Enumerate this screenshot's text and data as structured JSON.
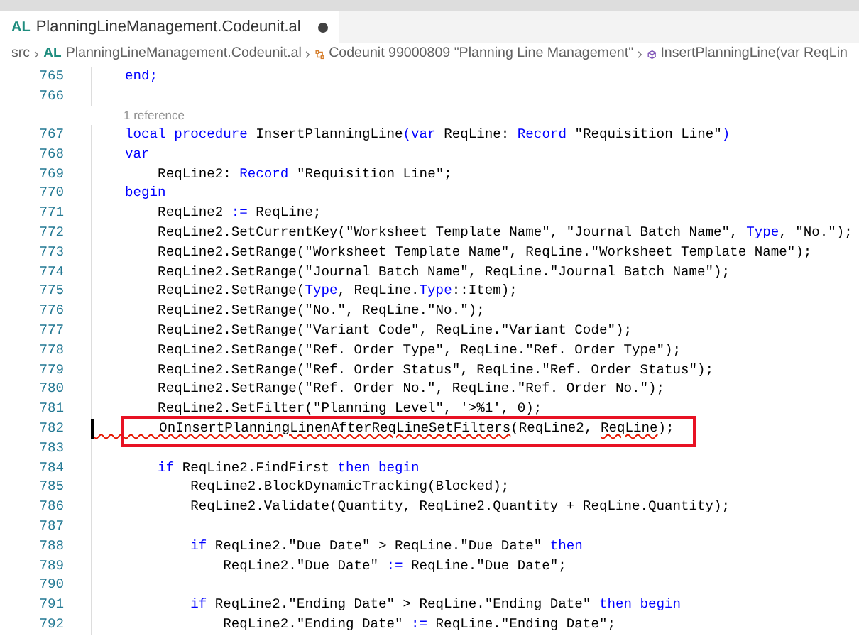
{
  "tab": {
    "lang": "AL",
    "title": "PlanningLineManagement.Codeunit.al",
    "modified": true
  },
  "breadcrumb": [
    {
      "kind": "folder",
      "text": "src"
    },
    {
      "kind": "file",
      "lang": "AL",
      "text": "PlanningLineManagement.Codeunit.al"
    },
    {
      "kind": "codeunit",
      "text": "Codeunit 99000809 \"Planning Line Management\""
    },
    {
      "kind": "method",
      "text": "InsertPlanningLine(var ReqLin"
    }
  ],
  "lines": [
    {
      "number": "765",
      "highlighted": false,
      "current": false,
      "segments": [
        {
          "kind": "keyword",
          "text": "    end;"
        }
      ]
    },
    {
      "number": "766",
      "highlighted": false,
      "current": false
    },
    {
      "kind": "codelens",
      "text": "1 reference"
    },
    {
      "number": "767",
      "highlighted": false,
      "current": false,
      "segments": [
        {
          "kind": "keyword",
          "text": "    local procedure "
        },
        {
          "kind": "plain",
          "text": "InsertPlanningLine"
        },
        {
          "kind": "keyword",
          "text": "(var "
        },
        {
          "kind": "plain",
          "text": "ReqLine: "
        },
        {
          "kind": "keyword",
          "text": "Record "
        },
        {
          "kind": "plain",
          "text": "\"Requisition Line\""
        },
        {
          "kind": "keyword",
          "text": ")"
        }
      ]
    },
    {
      "number": "768",
      "highlighted": false,
      "current": false,
      "segments": [
        {
          "kind": "keyword",
          "text": "    var"
        }
      ]
    },
    {
      "number": "769",
      "highlighted": false,
      "current": false,
      "segments": [
        {
          "kind": "plain",
          "text": "        ReqLine2: "
        },
        {
          "kind": "keyword",
          "text": "Record "
        },
        {
          "kind": "plain",
          "text": "\"Requisition Line\";"
        }
      ]
    },
    {
      "number": "770",
      "highlighted": false,
      "current": false,
      "segments": [
        {
          "kind": "keyword",
          "text": "    begin"
        }
      ]
    },
    {
      "number": "771",
      "highlighted": false,
      "current": false,
      "segments": [
        {
          "kind": "plain",
          "text": "        ReqLine2 "
        },
        {
          "kind": "keyword",
          "text": ":="
        },
        {
          "kind": "plain",
          "text": " ReqLine;"
        }
      ]
    },
    {
      "number": "772",
      "highlighted": false,
      "current": false,
      "segments": [
        {
          "kind": "plain",
          "text": "        ReqLine2.SetCurrentKey(\"Worksheet Template Name\", \"Journal Batch Name\", "
        },
        {
          "kind": "keyword",
          "text": "Type"
        },
        {
          "kind": "plain",
          "text": ", \"No.\");"
        }
      ]
    },
    {
      "number": "773",
      "highlighted": false,
      "current": false,
      "segments": [
        {
          "kind": "plain",
          "text": "        ReqLine2.SetRange(\"Worksheet Template Name\", ReqLine.\"Worksheet Template Name\");"
        }
      ]
    },
    {
      "number": "774",
      "highlighted": false,
      "current": false,
      "segments": [
        {
          "kind": "plain",
          "text": "        ReqLine2.SetRange(\"Journal Batch Name\", ReqLine.\"Journal Batch Name\");"
        }
      ]
    },
    {
      "number": "775",
      "highlighted": false,
      "current": false,
      "segments": [
        {
          "kind": "plain",
          "text": "        ReqLine2.SetRange("
        },
        {
          "kind": "keyword",
          "text": "Type"
        },
        {
          "kind": "plain",
          "text": ", ReqLine."
        },
        {
          "kind": "keyword",
          "text": "Type"
        },
        {
          "kind": "plain",
          "text": "::Item);"
        }
      ]
    },
    {
      "number": "776",
      "highlighted": false,
      "current": false,
      "segments": [
        {
          "kind": "plain",
          "text": "        ReqLine2.SetRange(\"No.\", ReqLine.\"No.\");"
        }
      ]
    },
    {
      "number": "777",
      "highlighted": false,
      "current": false,
      "segments": [
        {
          "kind": "plain",
          "text": "        ReqLine2.SetRange(\"Variant Code\", ReqLine.\"Variant Code\");"
        }
      ]
    },
    {
      "number": "778",
      "highlighted": false,
      "current": false,
      "segments": [
        {
          "kind": "plain",
          "text": "        ReqLine2.SetRange(\"Ref. Order Type\", ReqLine.\"Ref. Order Type\");"
        }
      ]
    },
    {
      "number": "779",
      "highlighted": false,
      "current": false,
      "segments": [
        {
          "kind": "plain",
          "text": "        ReqLine2.SetRange(\"Ref. Order Status\", ReqLine.\"Ref. Order Status\");"
        }
      ]
    },
    {
      "number": "780",
      "highlighted": false,
      "current": false,
      "segments": [
        {
          "kind": "plain",
          "text": "        ReqLine2.SetRange(\"Ref. Order No.\", ReqLine.\"Ref. Order No.\");"
        }
      ]
    },
    {
      "number": "781",
      "highlighted": false,
      "current": false,
      "segments": [
        {
          "kind": "plain",
          "text": "        ReqLine2.SetFilter(\"Planning Level\", '>%1', 0);"
        }
      ]
    },
    {
      "number": "782",
      "highlighted": true,
      "current": true,
      "segments": [
        {
          "kind": "error",
          "text": "        OnInsertPlanningLinenAfterReqLineSetFilters"
        },
        {
          "kind": "plain",
          "text": "(ReqLine2, "
        },
        {
          "kind": "error",
          "text": "ReqLine"
        },
        {
          "kind": "plain",
          "text": ");"
        }
      ]
    },
    {
      "number": "783",
      "highlighted": false,
      "current": false
    },
    {
      "number": "784",
      "highlighted": false,
      "current": false,
      "segments": [
        {
          "kind": "keyword",
          "text": "        if "
        },
        {
          "kind": "plain",
          "text": "ReqLine2.FindFirst "
        },
        {
          "kind": "keyword",
          "text": "then begin"
        }
      ]
    },
    {
      "number": "785",
      "highlighted": false,
      "current": false,
      "segments": [
        {
          "kind": "plain",
          "text": "            ReqLine2.BlockDynamicTracking(Blocked);"
        }
      ]
    },
    {
      "number": "786",
      "highlighted": false,
      "current": false,
      "segments": [
        {
          "kind": "plain",
          "text": "            ReqLine2.Validate(Quantity, ReqLine2.Quantity + ReqLine.Quantity);"
        }
      ]
    },
    {
      "number": "787",
      "highlighted": false,
      "current": false
    },
    {
      "number": "788",
      "highlighted": false,
      "current": false,
      "segments": [
        {
          "kind": "keyword",
          "text": "            if "
        },
        {
          "kind": "plain",
          "text": "ReqLine2.\"Due Date\" > ReqLine.\"Due Date\" "
        },
        {
          "kind": "keyword",
          "text": "then"
        }
      ]
    },
    {
      "number": "789",
      "highlighted": false,
      "current": false,
      "segments": [
        {
          "kind": "plain",
          "text": "                ReqLine2.\"Due Date\" "
        },
        {
          "kind": "keyword",
          "text": ":="
        },
        {
          "kind": "plain",
          "text": " ReqLine.\"Due Date\";"
        }
      ]
    },
    {
      "number": "790",
      "highlighted": false,
      "current": false
    },
    {
      "number": "791",
      "highlighted": false,
      "current": false,
      "segments": [
        {
          "kind": "keyword",
          "text": "            if "
        },
        {
          "kind": "plain",
          "text": "ReqLine2.\"Ending Date\" > ReqLine.\"Ending Date\" "
        },
        {
          "kind": "keyword",
          "text": "then begin"
        }
      ]
    },
    {
      "number": "792",
      "highlighted": false,
      "current": false,
      "segments": [
        {
          "kind": "plain",
          "text": "                ReqLine2.\"Ending Date\" "
        },
        {
          "kind": "keyword",
          "text": ":="
        },
        {
          "kind": "plain",
          "text": " ReqLine.\"Ending Date\";"
        }
      ]
    }
  ]
}
